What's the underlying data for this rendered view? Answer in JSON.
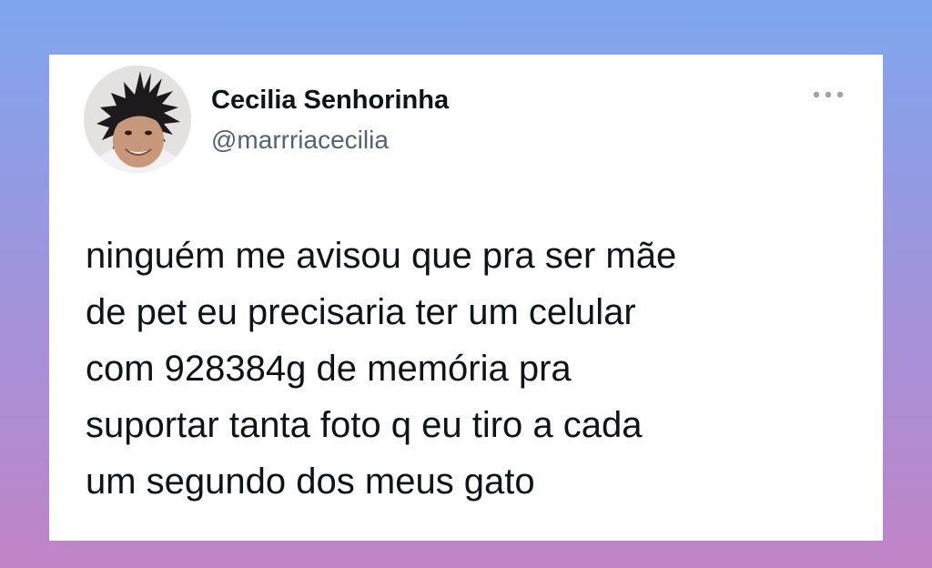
{
  "tweet": {
    "display_name": "Cecilia Senhorinha",
    "handle": "@marrriacecilia",
    "text_lines": [
      "ninguém me avisou que pra ser mãe",
      "de pet eu precisaria ter um celular",
      "com 928384g de memória pra",
      "suportar tanta foto q eu tiro a cada",
      "um segundo dos meus gato"
    ]
  },
  "icons": {
    "avatar": "profile-photo",
    "more": "more-horizontal-icon"
  },
  "colors": {
    "background_top": "#7ea7ee",
    "background_bottom": "#c184c7",
    "card": "#ffffff",
    "text_primary": "#0f1419",
    "text_secondary": "#536471"
  }
}
